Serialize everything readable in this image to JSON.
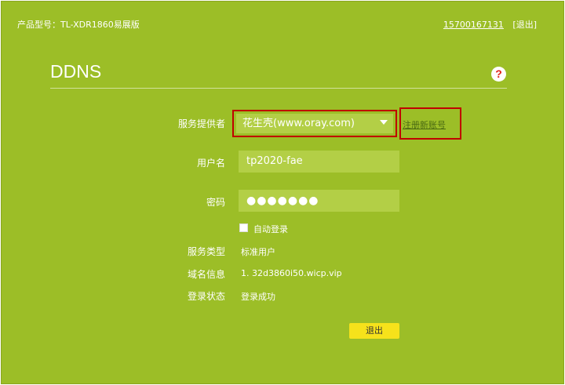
{
  "header": {
    "model": "产品型号：TL-XDR1860易展版",
    "account": "15700167131",
    "logout": "[退出]"
  },
  "page": {
    "title": "DDNS",
    "help_icon": "?"
  },
  "form": {
    "provider_label": "服务提供者",
    "provider_value": "花生壳(www.oray.com)",
    "register_link": "注册新账号",
    "username_label": "用户名",
    "username_value": "tp2020-fae",
    "password_label": "密码",
    "password_value": "●●●●●●●",
    "auto_login_label": "自动登录",
    "auto_login_checked": false,
    "service_type_label": "服务类型",
    "service_type_value": "标准用户",
    "domain_label": "域名信息",
    "domain_value": "1. 32d3860i50.wicp.vip",
    "login_status_label": "登录状态",
    "login_status_value": "登录成功",
    "logout_button": "退出"
  },
  "colors": {
    "background": "#9cbe27",
    "field": "#b3cf46",
    "highlight_border": "#c00000",
    "button": "#f6e21b",
    "help_icon": "#e2231a"
  }
}
